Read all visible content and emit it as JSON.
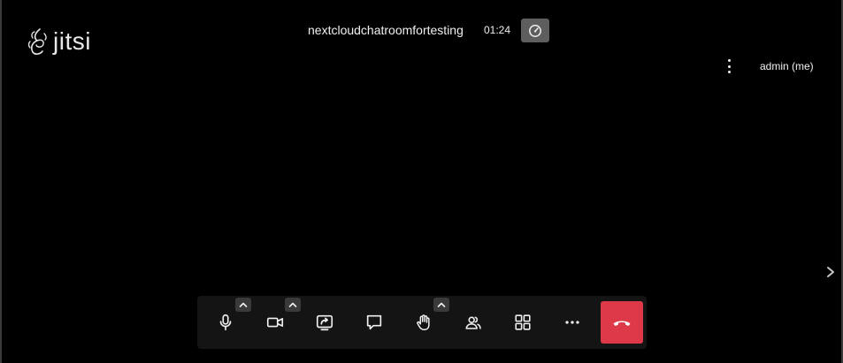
{
  "app": {
    "logo_text": "jitsi",
    "room_name": "nextcloudchatroomfortesting",
    "timer": "01:24",
    "self_name": "admin (me)"
  },
  "icons": {
    "quality": "gauge-icon",
    "menu": "more-vertical-icon",
    "filmstrip_toggle": "chevron-right-icon"
  },
  "toolbar": {
    "buttons": [
      {
        "name": "microphone",
        "icon": "microphone-icon",
        "has_caret": true
      },
      {
        "name": "camera",
        "icon": "video-camera-icon",
        "has_caret": true
      },
      {
        "name": "share-screen",
        "icon": "screen-share-icon",
        "has_caret": false
      },
      {
        "name": "chat",
        "icon": "chat-icon",
        "has_caret": false
      },
      {
        "name": "raise-hand",
        "icon": "hand-icon",
        "has_caret": true
      },
      {
        "name": "participants",
        "icon": "participants-icon",
        "has_caret": false
      },
      {
        "name": "tile-view",
        "icon": "grid-icon",
        "has_caret": false
      },
      {
        "name": "more-actions",
        "icon": "more-horizontal-icon",
        "has_caret": false
      },
      {
        "name": "leave",
        "icon": "hangup-icon",
        "has_caret": false
      }
    ]
  },
  "colors": {
    "background": "#000000",
    "toolbar": "#141414",
    "hangup": "#dd3949",
    "caret": "#3a3a3a",
    "quality_button": "#5e5e5e"
  }
}
